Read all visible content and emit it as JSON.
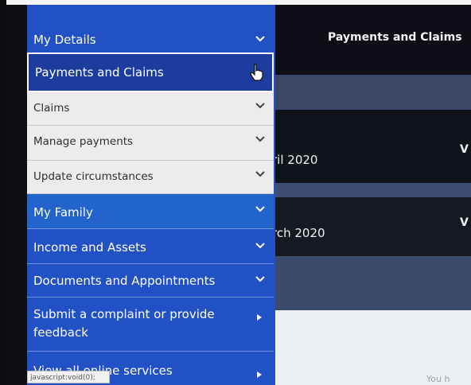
{
  "main": {
    "title": "Payments and Claims",
    "cards": [
      {
        "text": "ril 2020",
        "v": "V"
      },
      {
        "text": "rch 2020",
        "v": "V"
      }
    ],
    "footer_text": "You h"
  },
  "sidebar": {
    "items": [
      {
        "label": "My Details",
        "icon": "chevron-down-icon"
      },
      {
        "label": "Payments and Claims",
        "icon": "hand-cursor-icon"
      },
      {
        "label": "Claims",
        "icon": "chevron-down-icon"
      },
      {
        "label": "Manage payments",
        "icon": "chevron-down-icon"
      },
      {
        "label": "Update circumstances",
        "icon": "chevron-down-icon"
      },
      {
        "label": "My Family",
        "icon": "chevron-down-icon"
      },
      {
        "label": "Income and Assets",
        "icon": "chevron-down-icon"
      },
      {
        "label": "Documents and Appointments",
        "icon": "chevron-down-icon"
      },
      {
        "label": "Submit a complaint or provide feedback",
        "icon": "triangle-right-icon"
      },
      {
        "label": "View all online services",
        "icon": "triangle-right-icon"
      }
    ]
  },
  "status_bar": {
    "text": "javascript:void(0);"
  },
  "colors": {
    "sidebar_blue": "#2251c5",
    "active_blue": "#1d3d9e",
    "submenu_bg": "#ececee",
    "main_bg": "#0d0d14"
  }
}
